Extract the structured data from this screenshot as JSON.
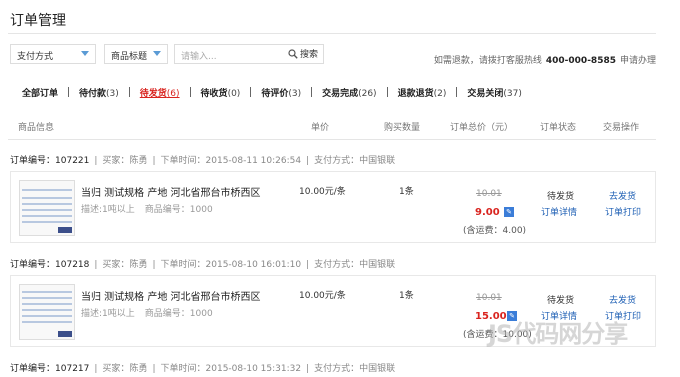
{
  "page": {
    "title": "订单管理"
  },
  "filters": {
    "payment_select": "支付方式",
    "product_select": "商品标题",
    "search_placeholder": "请输入...",
    "search_label": "搜索",
    "refund_note_prefix": "如需退款，请拨打客服热线",
    "refund_phone": "400-000-8585",
    "refund_note_suffix": "申请办理"
  },
  "tabs": [
    {
      "label": "全部订单",
      "count": ""
    },
    {
      "label": "待付款",
      "count": "(3)"
    },
    {
      "label": "待发货",
      "count": "(6)"
    },
    {
      "label": "待收货",
      "count": "(0)"
    },
    {
      "label": "待评价",
      "count": "(3)"
    },
    {
      "label": "交易完成",
      "count": "(26)"
    },
    {
      "label": "退款退货",
      "count": "(2)"
    },
    {
      "label": "交易关闭",
      "count": "(37)"
    }
  ],
  "columns": [
    "商品信息",
    "单价",
    "购买数量",
    "订单总价（元）",
    "订单状态",
    "交易操作"
  ],
  "orders": [
    {
      "number_label": "订单编号：",
      "number": "107221",
      "buyer_label": "买家：",
      "buyer": "陈勇",
      "time_label": "下单时间：",
      "time": "2015-08-11 10:26:54",
      "pay_label": "支付方式：",
      "pay": "中国银联",
      "product": "当归 测试规格 产地 河北省邢台市桥西区",
      "desc": "描述:1吨以上",
      "item_no": "商品编号：1000",
      "unit_price": "10.00元/条",
      "qty": "1条",
      "orig_total": "10.01",
      "total": "9.00",
      "shipping": "(含运费：4.00)",
      "status": "待发货",
      "detail": "订单详情",
      "action1": "去发货",
      "action2": "订单打印"
    },
    {
      "number_label": "订单编号：",
      "number": "107218",
      "buyer_label": "买家：",
      "buyer": "陈勇",
      "time_label": "下单时间：",
      "time": "2015-08-10 16:01:10",
      "pay_label": "支付方式：",
      "pay": "中国银联",
      "product": "当归 测试规格 产地 河北省邢台市桥西区",
      "desc": "描述:1吨以上",
      "item_no": "商品编号：1000",
      "unit_price": "10.00元/条",
      "qty": "1条",
      "orig_total": "10.01",
      "total": "15.00",
      "shipping": "(含运费：10.00)",
      "status": "待发货",
      "detail": "订单详情",
      "action1": "去发货",
      "action2": "订单打印"
    },
    {
      "number_label": "订单编号：",
      "number": "107217",
      "buyer_label": "买家：",
      "buyer": "陈勇",
      "time_label": "下单时间：",
      "time": "2015-08-10 15:31:32",
      "pay_label": "支付方式：",
      "pay": "中国银联"
    }
  ],
  "watermark": "JS代码网分享"
}
